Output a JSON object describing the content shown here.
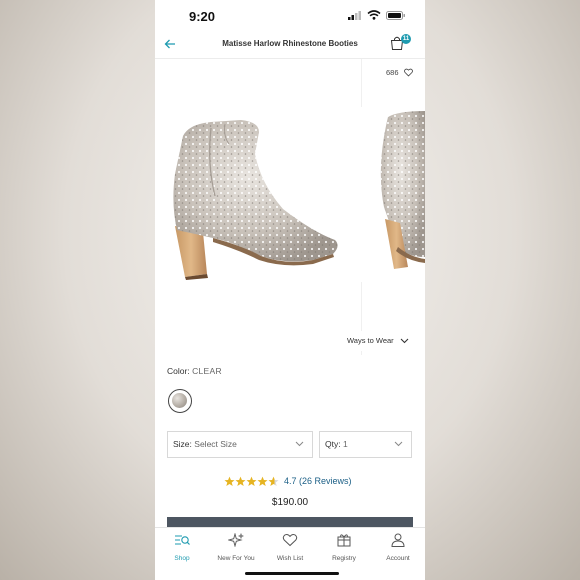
{
  "status": {
    "time": "9:20"
  },
  "header": {
    "title": "Matisse Harlow Rhinestone Booties",
    "bag_count": "11"
  },
  "gallery": {
    "favorites_count": "686",
    "ways_to_wear": "Ways to Wear"
  },
  "color": {
    "label": "Color:",
    "value": "CLEAR"
  },
  "size_select": {
    "label": "Size:",
    "value": "Select Size"
  },
  "qty_select": {
    "label": "Qty:",
    "value": "1"
  },
  "rating": {
    "stars": 4.7,
    "text": "4.7 (26 Reviews)"
  },
  "price": "$190.00",
  "tabs": [
    {
      "label": "Shop",
      "icon": "shop-search-icon",
      "active": true
    },
    {
      "label": "New For You",
      "icon": "sparkle-icon",
      "active": false
    },
    {
      "label": "Wish List",
      "icon": "heart-icon",
      "active": false
    },
    {
      "label": "Registry",
      "icon": "gift-icon",
      "active": false
    },
    {
      "label": "Account",
      "icon": "person-icon",
      "active": false
    }
  ],
  "colors": {
    "accent": "#1e9bb0",
    "link": "#1b5f86",
    "star": "#e6b422",
    "button": "#4d5661"
  }
}
